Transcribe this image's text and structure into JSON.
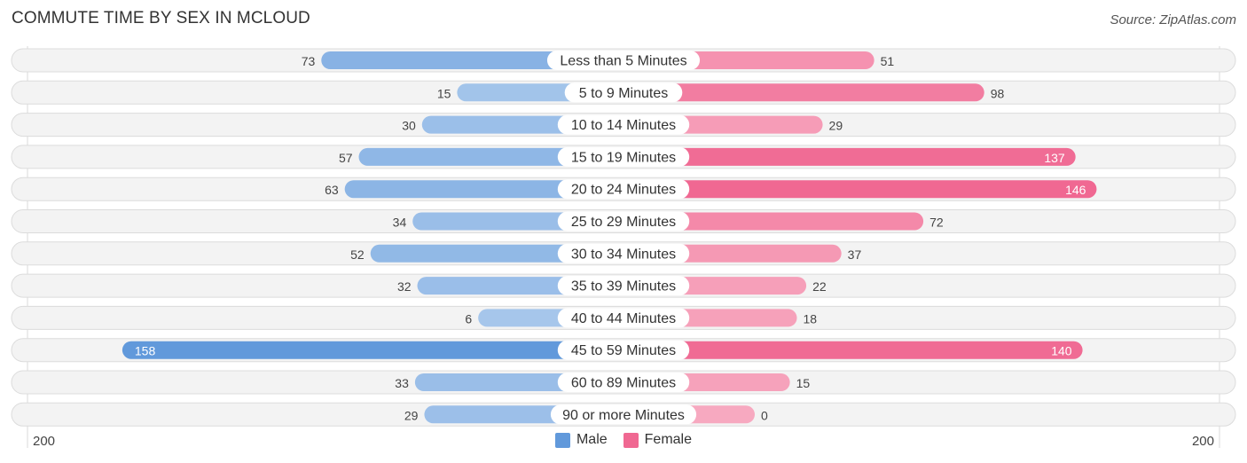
{
  "header": {
    "title": "COMMUTE TIME BY SEX IN MCLOUD",
    "source": "Source: ZipAtlas.com"
  },
  "axis": {
    "left_label": "200",
    "right_label": "200"
  },
  "legend": {
    "male_label": "Male",
    "female_label": "Female"
  },
  "colors": {
    "male_strong": "#6199db",
    "male_light": "#a9c8ec",
    "female_strong": "#f06892",
    "female_light": "#f7a9c0",
    "row_bg": "#f3f3f3"
  },
  "chart_data": {
    "type": "bar",
    "orientation": "horizontal-diverging",
    "title": "COMMUTE TIME BY SEX IN MCLOUD",
    "categories": [
      "Less than 5 Minutes",
      "5 to 9 Minutes",
      "10 to 14 Minutes",
      "15 to 19 Minutes",
      "20 to 24 Minutes",
      "25 to 29 Minutes",
      "30 to 34 Minutes",
      "35 to 39 Minutes",
      "40 to 44 Minutes",
      "45 to 59 Minutes",
      "60 to 89 Minutes",
      "90 or more Minutes"
    ],
    "series": [
      {
        "name": "Male",
        "side": "left",
        "values": [
          73,
          15,
          30,
          57,
          63,
          34,
          52,
          32,
          6,
          158,
          33,
          29
        ]
      },
      {
        "name": "Female",
        "side": "right",
        "values": [
          51,
          98,
          29,
          137,
          146,
          72,
          37,
          22,
          18,
          140,
          15,
          0
        ]
      }
    ],
    "xlim": [
      0,
      200
    ],
    "xlabel_left": "200",
    "xlabel_right": "200",
    "legend_position": "bottom-center",
    "grid": false
  }
}
